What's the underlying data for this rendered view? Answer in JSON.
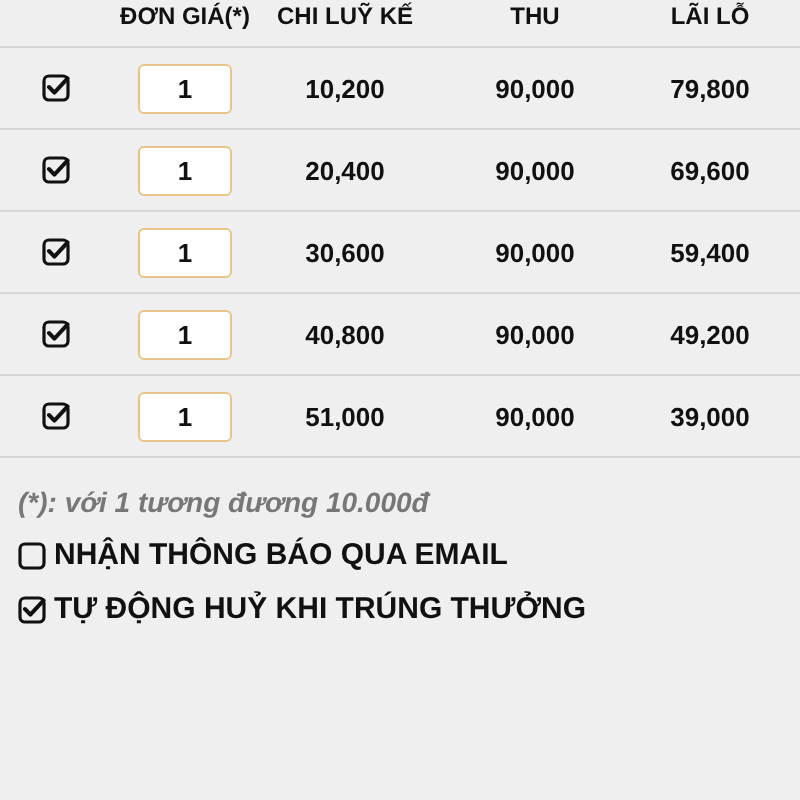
{
  "table": {
    "columns": [
      "ĐƠN GIÁ(*)",
      "CHI LUỸ KẾ",
      "THU",
      "LÃI LỖ"
    ],
    "rows": [
      {
        "checked": true,
        "unit_price": "1",
        "cumulative": "10,200",
        "income": "90,000",
        "profit": "79,800"
      },
      {
        "checked": true,
        "unit_price": "1",
        "cumulative": "20,400",
        "income": "90,000",
        "profit": "69,600"
      },
      {
        "checked": true,
        "unit_price": "1",
        "cumulative": "30,600",
        "income": "90,000",
        "profit": "59,400"
      },
      {
        "checked": true,
        "unit_price": "1",
        "cumulative": "40,800",
        "income": "90,000",
        "profit": "49,200"
      },
      {
        "checked": true,
        "unit_price": "1",
        "cumulative": "51,000",
        "income": "90,000",
        "profit": "39,000"
      }
    ]
  },
  "note": "(*): với 1 tương đương 10.000đ",
  "options": [
    {
      "label": "NHẬN THÔNG BÁO QUA EMAIL",
      "checked": false
    },
    {
      "label": "TỰ ĐỘNG HUỶ KHI TRÚNG THƯỞNG",
      "checked": true
    }
  ]
}
